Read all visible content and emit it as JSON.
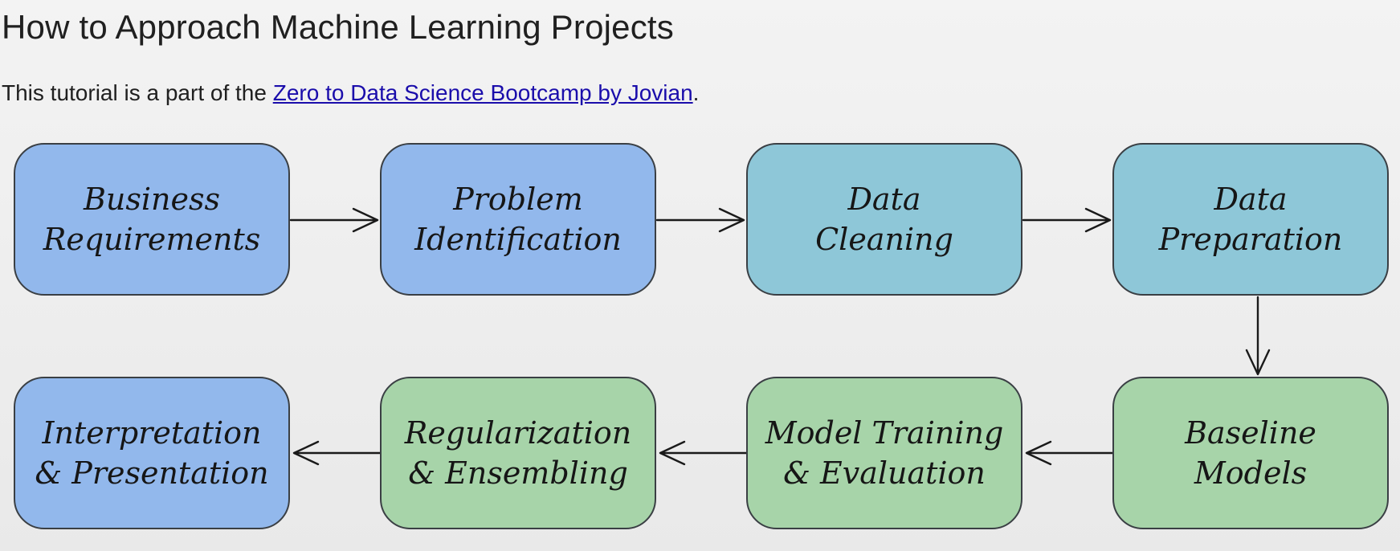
{
  "page": {
    "title": "How to Approach Machine Learning Projects",
    "intro_prefix": "This tutorial is a part of the ",
    "intro_link": "Zero to Data Science Bootcamp by Jovian",
    "intro_suffix": "."
  },
  "diagram": {
    "nodes": [
      {
        "id": "business-requirements",
        "label": "Business\nRequirements",
        "color": "#92b8ec"
      },
      {
        "id": "problem-identification",
        "label": "Problem\nIdentification",
        "color": "#92b8ec"
      },
      {
        "id": "data-cleaning",
        "label": "Data\nCleaning",
        "color": "#8ec7d8"
      },
      {
        "id": "data-preparation",
        "label": "Data\nPreparation",
        "color": "#8ec7d8"
      },
      {
        "id": "baseline-models",
        "label": "Baseline\nModels",
        "color": "#a7d4a9"
      },
      {
        "id": "model-training",
        "label": "Model Training\n& Evaluation",
        "color": "#a7d4a9"
      },
      {
        "id": "regularization",
        "label": "Regularization\n& Ensembling",
        "color": "#a7d4a9"
      },
      {
        "id": "interpretation",
        "label": "Interpretation\n& Presentation",
        "color": "#92b8ec"
      }
    ],
    "edges": [
      {
        "from": "business-requirements",
        "to": "problem-identification"
      },
      {
        "from": "problem-identification",
        "to": "data-cleaning"
      },
      {
        "from": "data-cleaning",
        "to": "data-preparation"
      },
      {
        "from": "data-preparation",
        "to": "baseline-models"
      },
      {
        "from": "baseline-models",
        "to": "model-training"
      },
      {
        "from": "model-training",
        "to": "regularization"
      },
      {
        "from": "regularization",
        "to": "interpretation"
      }
    ]
  }
}
